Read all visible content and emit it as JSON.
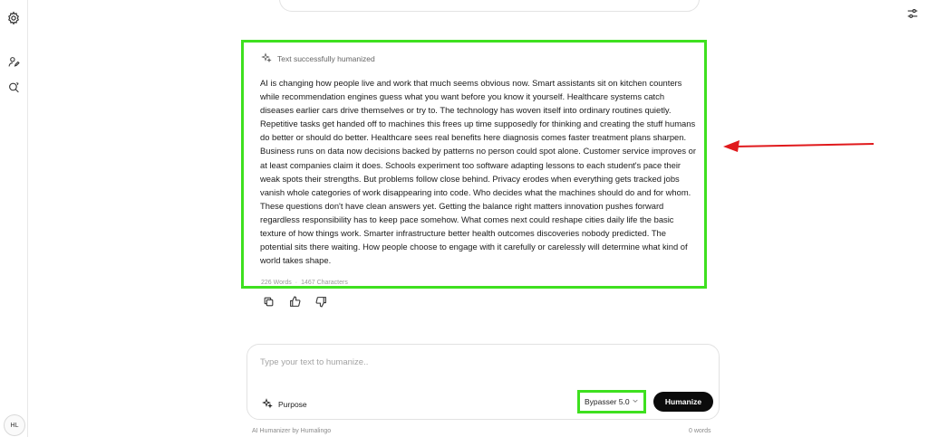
{
  "sidebar": {
    "items": [
      {
        "icon": "gear-icon"
      },
      {
        "icon": "user-edit-icon"
      },
      {
        "icon": "search-refresh-icon"
      }
    ],
    "avatar_initials": "HL"
  },
  "header": {
    "settings_icon": "sliders-icon"
  },
  "output": {
    "status": "Text successfully humanized",
    "text": "AI is changing how people live and work that much seems obvious now. Smart assistants sit on kitchen counters while recommendation engines guess what you want before you know it yourself. Healthcare systems catch diseases earlier cars drive themselves or try to. The technology has woven itself into ordinary routines quietly. Repetitive tasks get handed off to machines this frees up time supposedly for thinking and creating the stuff humans do better or should do better. Healthcare sees real benefits here diagnosis comes faster treatment plans sharpen. Business runs on data now decisions backed by patterns no person could spot alone. Customer service improves or at least companies claim it does. Schools experiment too software adapting lessons to each student's pace their weak spots their strengths. But problems follow close behind. Privacy erodes when everything gets tracked jobs vanish whole categories of work disappearing into code. Who decides what the machines should do and for whom. These questions don't have clean answers yet. Getting the balance right matters innovation pushes forward regardless responsibility has to keep pace somehow. What comes next could reshape cities daily life the basic texture of how things work. Smarter infrastructure better health outcomes discoveries nobody predicted. The potential sits there waiting. How people choose to engage with it carefully or carelessly will determine what kind of world takes shape.",
    "word_count": "226 Words",
    "separator": "·",
    "char_count": "1467 Characters",
    "actions": [
      "copy-icon",
      "thumbs-up-icon",
      "thumbs-down-icon"
    ]
  },
  "input": {
    "value": "",
    "placeholder": "Type your text to humanize..",
    "purpose_label": "Purpose",
    "model_label": "Bypasser 5.0",
    "humanize_label": "Humanize"
  },
  "footer": {
    "left": "AI Humanizer by Humalingo",
    "right": "0 words"
  },
  "colors": {
    "highlight": "#3ee01f",
    "arrow": "#e0191c",
    "button": "#0b0b0b"
  }
}
